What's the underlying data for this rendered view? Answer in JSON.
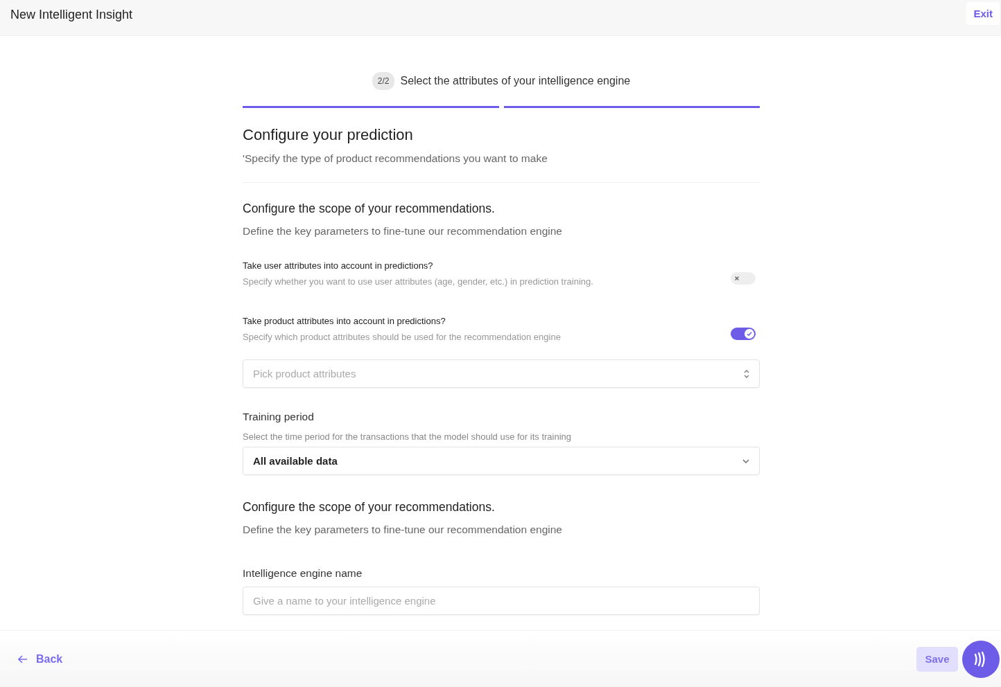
{
  "header": {
    "title": "New Intelligent Insight",
    "exit_button": "Exit"
  },
  "stepper": {
    "badge": "2/2",
    "label": "Select the attributes of your intelligence engine",
    "segments": [
      {
        "complete": true
      },
      {
        "complete": true
      }
    ]
  },
  "intro": {
    "title": "Configure your prediction",
    "subtitle": "'Specify the type of product recommendations you want to make"
  },
  "sections": [
    {
      "title": "Configure the scope of your recommendations.",
      "subtitle": "Define the key parameters to fine-tune our recommendation engine",
      "fields": [
        {
          "kind": "toggle",
          "label": "Take user attributes into account in predictions?",
          "description": "Specify whether you want to use user attributes (age, gender, etc.) in prediction training.",
          "on": false
        },
        {
          "kind": "toggle",
          "label": "Take product attributes into account in predictions?",
          "description": "Specify which product attributes should be used for the recommendation engine",
          "on": true
        },
        {
          "kind": "multiselect",
          "placeholder": "Pick product attributes"
        },
        {
          "kind": "select",
          "label": "Training period",
          "description": "Select the time period for the transactions that the model should use for its training",
          "value": "All available data"
        }
      ]
    },
    {
      "title": "Configure the scope of your recommendations.",
      "subtitle": "Define the key parameters to fine-tune our recommendation engine",
      "fields": [
        {
          "kind": "text",
          "label": "Intelligence engine name",
          "placeholder": "Give a name to your intelligence engine"
        }
      ]
    }
  ],
  "footer": {
    "back_button": "Back",
    "save_button": {
      "label": "Save",
      "disabled": true
    }
  }
}
